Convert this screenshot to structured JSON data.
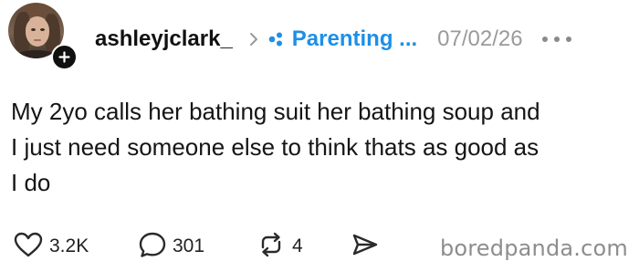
{
  "post": {
    "author": {
      "username": "ashleyjclark_",
      "avatar_icon": "profile-photo",
      "follow_icon": "plus-icon"
    },
    "community": {
      "name": "Parenting ...",
      "icon": "community-dots-icon",
      "color": "#1e8fe8"
    },
    "date": "07/02/26",
    "text_lines": [
      "My 2yo calls her bathing suit her bathing soup and",
      "I just need someone else to think thats as good as",
      "I do"
    ],
    "actions": {
      "likes": "3.2K",
      "comments": "301",
      "reposts": "4",
      "like_icon": "heart-icon",
      "comment_icon": "comment-bubble-icon",
      "repost_icon": "repost-icon",
      "share_icon": "send-icon"
    }
  },
  "watermark": "boredpanda.com"
}
